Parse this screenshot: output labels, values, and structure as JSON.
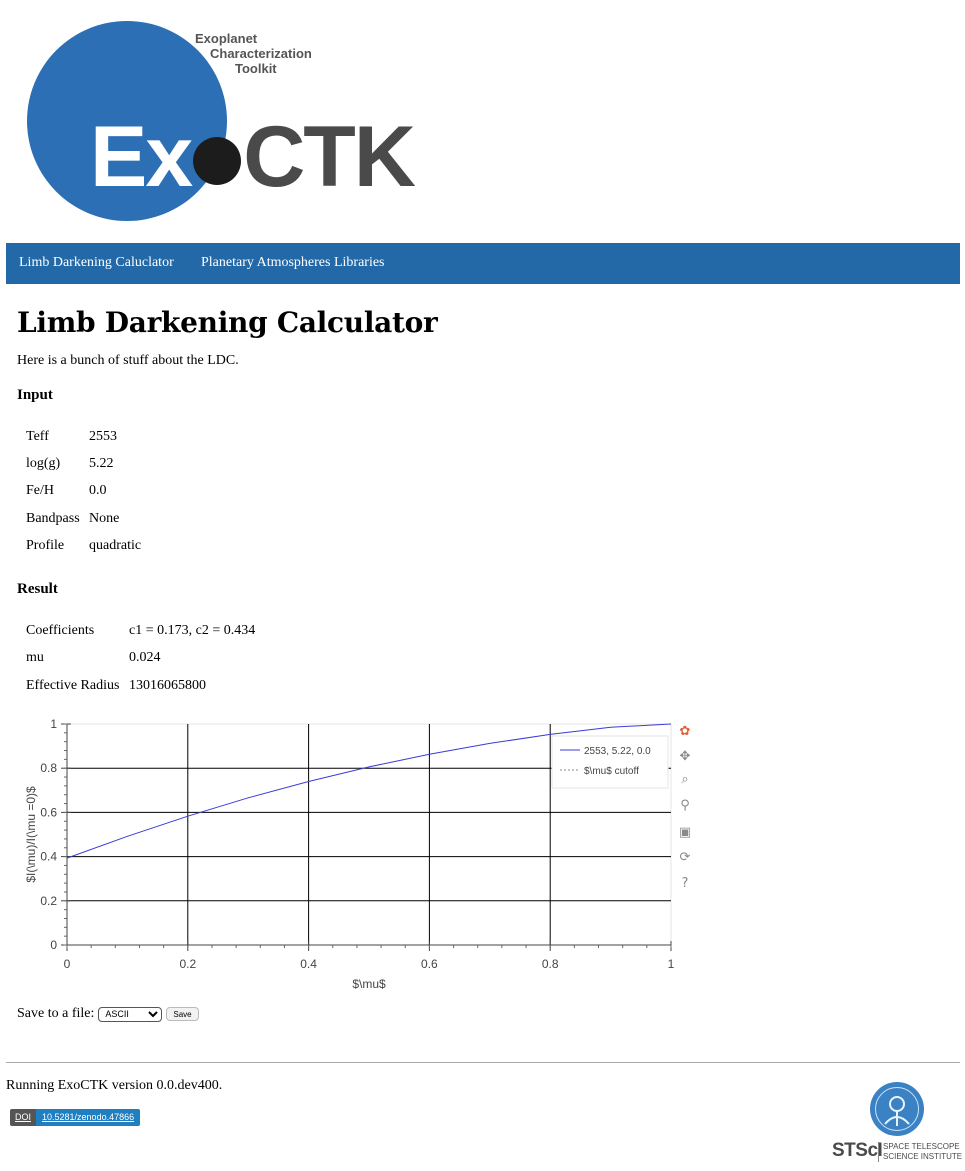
{
  "logo": {
    "line1": "Exoplanet",
    "line2": "Characterization",
    "line3": "Toolkit",
    "ex": "Ex",
    "ctk": "CTK",
    "circle_color": "#2c6fb5"
  },
  "nav": {
    "items": [
      {
        "label": "Limb Darkening Caluclator"
      },
      {
        "label": "Planetary Atmospheres Libraries"
      }
    ]
  },
  "page": {
    "title": "Limb Darkening Calculator",
    "intro": "Here is a bunch of stuff about the LDC."
  },
  "input": {
    "title": "Input",
    "rows": [
      {
        "key": "Teff",
        "value": "2553"
      },
      {
        "key": "log(g)",
        "value": "5.22"
      },
      {
        "key": "Fe/H",
        "value": "0.0"
      },
      {
        "key": "Bandpass",
        "value": "None"
      },
      {
        "key": "Profile",
        "value": "quadratic"
      }
    ]
  },
  "result": {
    "title": "Result",
    "rows": [
      {
        "key": "Coefficients",
        "value": "c1 = 0.173, c2 = 0.434"
      },
      {
        "key": "mu",
        "value": "0.024"
      },
      {
        "key": "Effective Radius",
        "value": "13016065800"
      }
    ]
  },
  "chart_data": {
    "type": "line",
    "xlabel": "$\\mu$",
    "ylabel": "$I(\\mu)/I(\\mu =0)$",
    "xlim": [
      0,
      1
    ],
    "ylim": [
      0,
      1
    ],
    "xticks": [
      "0",
      "0.2",
      "0.4",
      "0.6",
      "0.8",
      "1"
    ],
    "yticks": [
      "0",
      "0.2",
      "0.4",
      "0.6",
      "0.8",
      "1"
    ],
    "grid": true,
    "legend_position": "top-right",
    "series": [
      {
        "name": "2553, 5.22, 0.0",
        "style": "solid",
        "color": "#3b3bd6",
        "x": [
          0,
          0.1,
          0.2,
          0.3,
          0.4,
          0.5,
          0.6,
          0.7,
          0.8,
          0.9,
          1.0
        ],
        "y": [
          0.393,
          0.492,
          0.583,
          0.666,
          0.74,
          0.806,
          0.863,
          0.912,
          0.953,
          0.985,
          1.0
        ]
      },
      {
        "name": "$\\mu$ cutoff",
        "style": "dotted",
        "color": "#888888",
        "x": [],
        "y": []
      }
    ],
    "toolbar_icons": [
      "bokeh-logo-icon",
      "pan-icon",
      "box-zoom-icon",
      "wheel-zoom-icon",
      "save-icon",
      "reset-icon",
      "help-icon"
    ]
  },
  "save": {
    "label": "Save to a file:",
    "format": "ASCII",
    "button": "Save"
  },
  "footer": {
    "version": "Running ExoCTK version 0.0.dev400.",
    "doi_label": "DOI",
    "doi_value": "10.5281/zenodo.47866",
    "stsci_abbr": "STScI",
    "stsci_line1": "SPACE TELESCOPE",
    "stsci_line2": "SCIENCE INSTITUTE"
  }
}
